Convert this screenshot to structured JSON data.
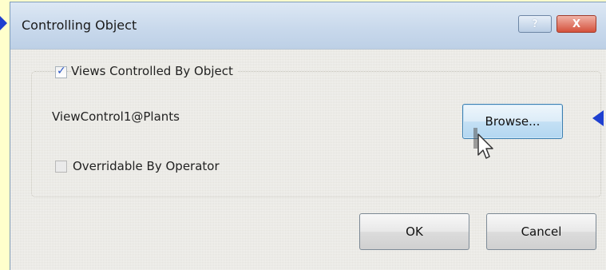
{
  "dialog": {
    "title": "Controlling Object",
    "help_glyph": "?",
    "close_glyph": "X"
  },
  "views_checkbox": {
    "label": "Views Controlled By Object",
    "checked": true
  },
  "controlling_object_value": "ViewControl1@Plants",
  "browse_button": "Browse...",
  "override_checkbox": {
    "label": "Overridable By Operator",
    "checked": false
  },
  "footer": {
    "ok_label": "OK",
    "cancel_label": "Cancel"
  },
  "colors": {
    "background": "#ffffcc",
    "callout_arrow": "#1e3fd0",
    "titlebar": "#c9d9ec",
    "close_button": "#d4513c"
  },
  "icons": {
    "callout_left": "triangle-arrow-icon",
    "callout_right": "triangle-arrow-icon",
    "cursor": "mouse-pointer-icon"
  }
}
